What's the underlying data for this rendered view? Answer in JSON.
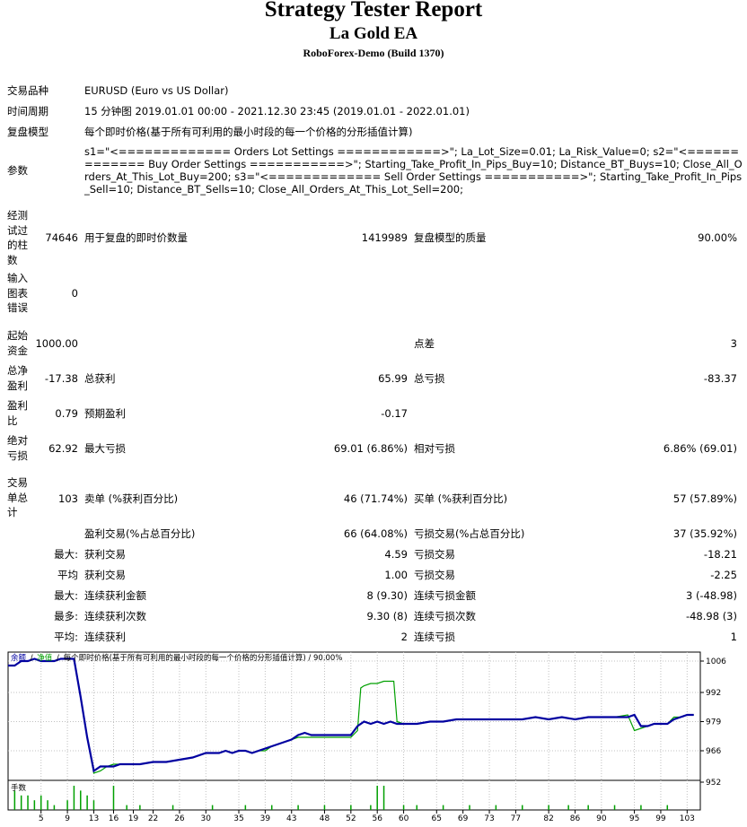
{
  "header": {
    "title": "Strategy Tester Report",
    "ea_name": "La Gold EA",
    "server": "RoboForex-Demo (Build 1370)"
  },
  "info": {
    "symbol_label": "交易品种",
    "symbol_value": "EURUSD (Euro vs US Dollar)",
    "period_label": "时间周期",
    "period_value": "15 分钟图 2019.01.01 00:00 - 2021.12.30 23:45 (2019.01.01 - 2022.01.01)",
    "model_label": "复盘模型",
    "model_value": "每个即时价格(基于所有可利用的最小时段的每一个价格的分形插值计算)",
    "params_label": "参数",
    "params_value": "s1=\"<============= Orders Lot Settings ============>\"; La_Lot_Size=0.01; La_Risk_Value=0; s2=\"<============= Buy Order Settings ===========>\"; Starting_Take_Profit_In_Pips_Buy=10; Distance_BT_Buys=10; Close_All_Orders_At_This_Lot_Buy=200; s3=\"<============= Sell Order Settings ===========>\"; Starting_Take_Profit_In_Pips_Sell=10; Distance_BT_Sells=10; Close_All_Orders_At_This_Lot_Sell=200;"
  },
  "stats": {
    "bars_label": "经测试过的柱数",
    "bars_value": "74646",
    "ticks_label": "用于复盘的即时价数量",
    "ticks_value": "1419989",
    "quality_label": "复盘模型的质量",
    "quality_value": "90.00%",
    "errors_label": "输入图表错误",
    "errors_value": "0",
    "deposit_label": "起始资金",
    "deposit_value": "1000.00",
    "spread_label": "点差",
    "spread_value": "3",
    "net_label": "总净盈利",
    "net_value": "-17.38",
    "gross_profit_label": "总获利",
    "gross_profit_value": "65.99",
    "gross_loss_label": "总亏损",
    "gross_loss_value": "-83.37",
    "pf_label": "盈利比",
    "pf_value": "0.79",
    "expected_label": "预期盈利",
    "expected_value": "-0.17",
    "abs_dd_label": "绝对亏损",
    "abs_dd_value": "62.92",
    "max_dd_label": "最大亏损",
    "max_dd_value": "69.01 (6.86%)",
    "rel_dd_label": "相对亏损",
    "rel_dd_value": "6.86% (69.01)",
    "trades_label": "交易单总计",
    "trades_value": "103",
    "short_label": "卖单 (%获利百分比)",
    "short_value": "46 (71.74%)",
    "long_label": "买单 (%获利百分比)",
    "long_value": "57 (57.89%)",
    "profit_trades_label": "盈利交易(%占总百分比)",
    "profit_trades_value": "66 (64.08%)",
    "loss_trades_label": "亏损交易(%占总百分比)",
    "loss_trades_value": "37 (35.92%)",
    "largest_prefix": "最大:",
    "largest_profit_label": "获利交易",
    "largest_profit_value": "4.59",
    "largest_loss_label": "亏损交易",
    "largest_loss_value": "-18.21",
    "average_prefix": "平均",
    "average_profit_label": "获利交易",
    "average_profit_value": "1.00",
    "average_loss_label": "亏损交易",
    "average_loss_value": "-2.25",
    "maxcons_prefix": "最大:",
    "maxcons_win_label": "连续获利金额",
    "maxcons_win_value": "8 (9.30)",
    "maxcons_loss_label": "连续亏损金额",
    "maxcons_loss_value": "3 (-48.98)",
    "maxconsc_prefix": "最多:",
    "maxconsc_win_label": "连续获利次数",
    "maxconsc_win_value": "9.30 (8)",
    "maxconsc_loss_label": "连续亏损次数",
    "maxconsc_loss_value": "-48.98 (3)",
    "avgcons_prefix": "平均:",
    "avgcons_win_label": "连续获利",
    "avgcons_win_value": "2",
    "avgcons_loss_label": "连续亏损",
    "avgcons_loss_value": "1"
  },
  "chart_data": {
    "type": "line",
    "legend": {
      "balance": "余额",
      "equity": "净值",
      "separator": "/",
      "description": "每个即时价格(基于所有可利用的最小时段的每一个价格的分形插值计算) / 90.00%"
    },
    "colors": {
      "balance": "#0000a0",
      "equity": "#00a000",
      "volume": "#00a000",
      "legend_balance": "#0000a0",
      "legend_equity": "#00a000"
    },
    "y_ticks": [
      1006,
      992,
      979,
      966,
      952
    ],
    "ylim": [
      952,
      1010
    ],
    "x_ticks": [
      5,
      9,
      13,
      16,
      19,
      22,
      26,
      30,
      35,
      39,
      43,
      48,
      52,
      56,
      60,
      65,
      69,
      73,
      77,
      82,
      86,
      90,
      95,
      99,
      103
    ],
    "xlim": [
      0,
      105
    ],
    "series": [
      {
        "key": "balance",
        "x": [
          0,
          1,
          2,
          3,
          4,
          5,
          6,
          7,
          8,
          9,
          10,
          11,
          12,
          13,
          14,
          15,
          16,
          17,
          18,
          19,
          20,
          22,
          24,
          26,
          28,
          30,
          32,
          33,
          34,
          35,
          36,
          37,
          38,
          39,
          40,
          41,
          42,
          43,
          44,
          45,
          46,
          47,
          48,
          49,
          50,
          51,
          52,
          53,
          54,
          55,
          56,
          57,
          58,
          59,
          60,
          62,
          64,
          66,
          68,
          70,
          72,
          74,
          76,
          78,
          80,
          82,
          84,
          86,
          88,
          90,
          92,
          94,
          95,
          96,
          97,
          98,
          99,
          100,
          101,
          102,
          103,
          104
        ],
        "y": [
          1004,
          1004,
          1006,
          1006,
          1007,
          1006,
          1006,
          1006,
          1007,
          1007,
          1007,
          990,
          972,
          957,
          959,
          959,
          959,
          960,
          960,
          960,
          960,
          961,
          961,
          962,
          963,
          965,
          965,
          966,
          965,
          966,
          966,
          965,
          966,
          967,
          968,
          969,
          970,
          971,
          973,
          974,
          973,
          973,
          973,
          973,
          973,
          973,
          973,
          977,
          979,
          978,
          979,
          978,
          979,
          978,
          978,
          978,
          979,
          979,
          980,
          980,
          980,
          980,
          980,
          980,
          981,
          980,
          981,
          980,
          981,
          981,
          981,
          981,
          982,
          977,
          977,
          978,
          978,
          978,
          980,
          981,
          982,
          982
        ]
      },
      {
        "key": "equity",
        "x": [
          0,
          1,
          2,
          3,
          4,
          5,
          6,
          7,
          8,
          9,
          10,
          11,
          12,
          13,
          14,
          15,
          16,
          17,
          18,
          19,
          20,
          22,
          24,
          26,
          28,
          30,
          32,
          33,
          34,
          35,
          36,
          37,
          38,
          39,
          40,
          41,
          42,
          43,
          44,
          45,
          46,
          47,
          48,
          49,
          50,
          51,
          52,
          53,
          53.5,
          54,
          55,
          56,
          57,
          58,
          58.5,
          59,
          60,
          62,
          64,
          66,
          68,
          70,
          72,
          74,
          76,
          78,
          80,
          82,
          84,
          86,
          88,
          90,
          92,
          94,
          95,
          96,
          97,
          98,
          99,
          100,
          101,
          102,
          103,
          104
        ],
        "y": [
          1004,
          1004,
          1006,
          1006,
          1007,
          1006,
          1006,
          1006,
          1007,
          1007,
          1007,
          990,
          972,
          956,
          957,
          959,
          960,
          960,
          960,
          960,
          960,
          961,
          961,
          962,
          963,
          965,
          965,
          966,
          965,
          966,
          966,
          965,
          966,
          966,
          968,
          969,
          970,
          971,
          972,
          972,
          972,
          972,
          972,
          972,
          972,
          972,
          972,
          975,
          994,
          995,
          996,
          996,
          997,
          997,
          997,
          979,
          978,
          978,
          979,
          979,
          980,
          980,
          980,
          980,
          980,
          980,
          981,
          980,
          981,
          980,
          981,
          981,
          981,
          982,
          975,
          976,
          977,
          978,
          978,
          978,
          981,
          981,
          982,
          982
        ]
      }
    ],
    "volume": {
      "x": [
        1,
        2,
        3,
        4,
        5,
        6,
        7,
        9,
        10,
        11,
        12,
        13,
        16,
        18,
        20,
        25,
        31,
        36,
        40,
        44,
        48,
        52,
        55,
        56,
        57,
        60,
        62,
        66,
        70,
        74,
        78,
        82,
        85,
        88,
        92,
        96,
        100
      ],
      "values": [
        4,
        3,
        3,
        2,
        3,
        2,
        1,
        2,
        5,
        4,
        3,
        2,
        5,
        1,
        1,
        1,
        1,
        1,
        1,
        1,
        1,
        1,
        1,
        5,
        5,
        1,
        1,
        1,
        1,
        1,
        1,
        1,
        1,
        1,
        1,
        1,
        1
      ]
    },
    "volume_label": "手数"
  }
}
